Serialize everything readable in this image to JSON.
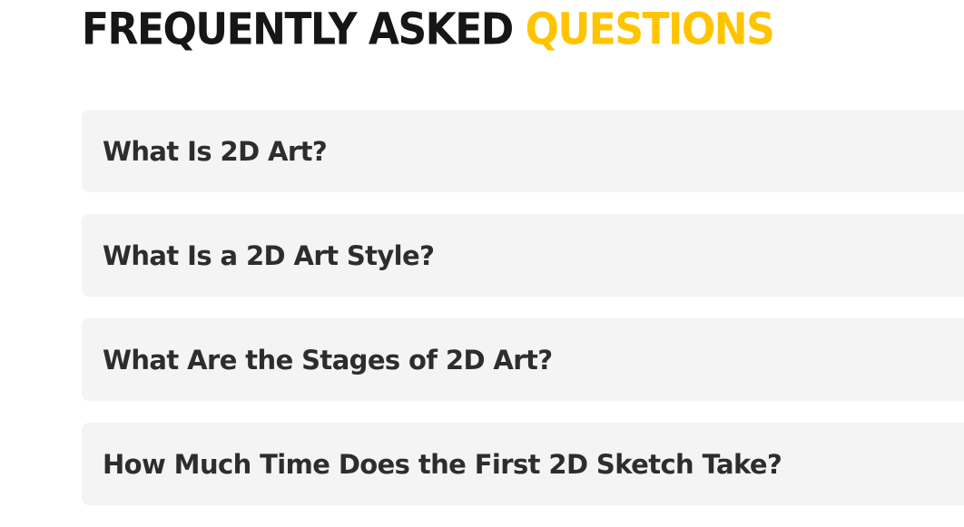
{
  "heading": {
    "main": "FREQUENTLY ASKED",
    "accent": "QUESTIONS",
    "accent_color": "#ffc400",
    "text_color": "#161616"
  },
  "faq": {
    "items": [
      {
        "question": "What Is 2D Art?"
      },
      {
        "question": "What Is a 2D Art Style?"
      },
      {
        "question": "What Are the Stages of 2D Art?"
      },
      {
        "question": "How Much Time Does the First 2D Sketch Take?"
      }
    ]
  }
}
